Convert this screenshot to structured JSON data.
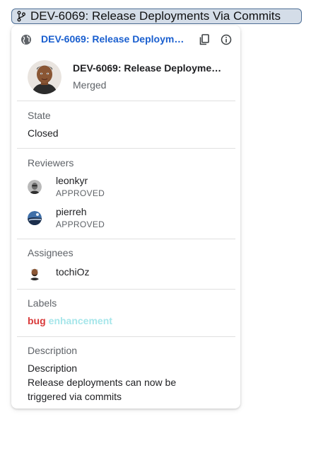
{
  "chip": {
    "text": "DEV-6069: Release Deployments Via Commits",
    "icon": "git-branch-icon"
  },
  "card": {
    "header": {
      "link_text": "DEV-6069: Release Deployments Via Commits",
      "globe_icon": "globe-icon",
      "copy_icon": "copy-icon",
      "info_icon": "info-icon"
    },
    "pr": {
      "title": "DEV-6069: Release Deployments Via Commits",
      "status": "Merged"
    },
    "state": {
      "label": "State",
      "value": "Closed"
    },
    "reviewers": {
      "label": "Reviewers",
      "items": [
        {
          "name": "leonkyr",
          "status": "APPROVED"
        },
        {
          "name": "pierreh",
          "status": "APPROVED"
        }
      ]
    },
    "assignees": {
      "label": "Assignees",
      "items": [
        {
          "name": "tochiOz"
        }
      ]
    },
    "labels": {
      "label": "Labels",
      "items": [
        {
          "text": "bug",
          "color": "#d93a3a"
        },
        {
          "text": "enhancement",
          "color": "#a6e6ea"
        }
      ]
    },
    "description": {
      "label": "Description",
      "lines": [
        "Description",
        "Release deployments can now be",
        "triggered via commits"
      ]
    }
  },
  "colors": {
    "link": "#1a5fcf",
    "chip_bg": "#d4dde8",
    "chip_border": "#4f6f96"
  }
}
